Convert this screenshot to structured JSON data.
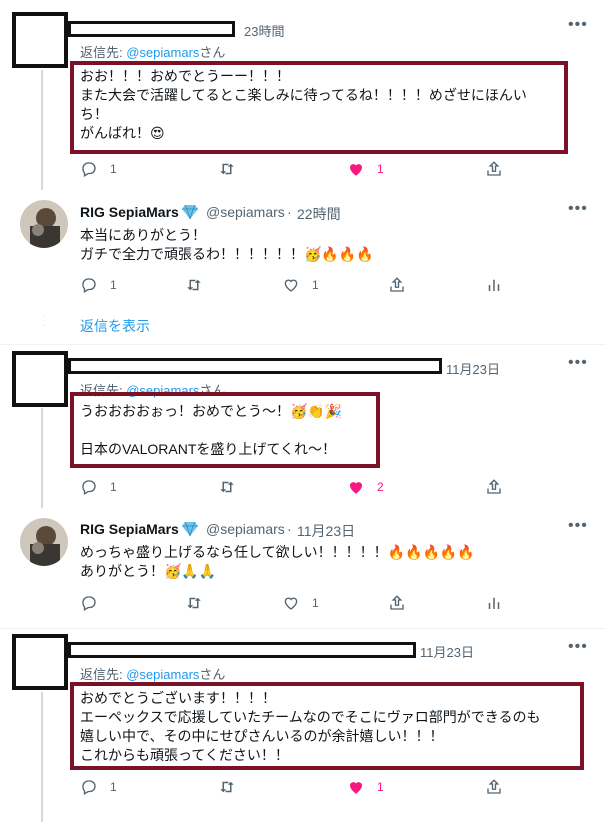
{
  "tweets": [
    {
      "time": "23時間",
      "reply_prefix": "返信先: ",
      "reply_user": "@sepiamars",
      "reply_suffix": "さん",
      "text": "おお！！！おめでとうーー！！！\nまた大会で活躍してるとこ楽しみに待ってるね！！！！めざせにほんい\nち！\nがんばれ！😍",
      "actions": {
        "reply": "1",
        "retweet": "",
        "like": "1",
        "liked": true
      }
    },
    {
      "name": "RIG SepiaMars",
      "handle": "@sepiamars",
      "time": "22時間",
      "text": "本当にありがとう！\nガチで全力で頑張るわ！！！！！！🥳🔥🔥🔥",
      "actions": {
        "reply": "1",
        "retweet": "",
        "like": "1",
        "liked": false
      }
    },
    {
      "time": "11月23日",
      "reply_prefix": "返信先: ",
      "reply_user": "@sepiamars",
      "reply_suffix": "さん",
      "text": "うおおおおぉっ！おめでとう～！🥳👏🎉\n\n日本のVALORANTを盛り上げてくれ～！",
      "actions": {
        "reply": "1",
        "retweet": "",
        "like": "2",
        "liked": true
      }
    },
    {
      "name": "RIG SepiaMars",
      "handle": "@sepiamars",
      "time": "11月23日",
      "text": "めっちゃ盛り上げるなら任して欲しい！！！！！🔥🔥🔥🔥🔥\nありがとう！🥳🙏🙏",
      "actions": {
        "reply": "",
        "retweet": "",
        "like": "1",
        "liked": false
      }
    },
    {
      "time": "11月23日",
      "reply_prefix": "返信先: ",
      "reply_user": "@sepiamars",
      "reply_suffix": "さん",
      "text": "おめでとうございます！！！！\nエーペックスで応援していたチームなのでそこにヴァロ部門ができるのも\n嬉しい中で、その中にせぴさんいるのが余計嬉しい！！！\nこれからも頑張ってください！！",
      "actions": {
        "reply": "1",
        "retweet": "",
        "like": "1",
        "liked": true
      }
    }
  ],
  "show_replies": "返信を表示",
  "more_icon": "more-icon",
  "verified_icon": "verified-diamond-icon",
  "colors": {
    "accent": "#1d9bf0",
    "like": "#f91880",
    "highlight_border": "#7a1225"
  }
}
